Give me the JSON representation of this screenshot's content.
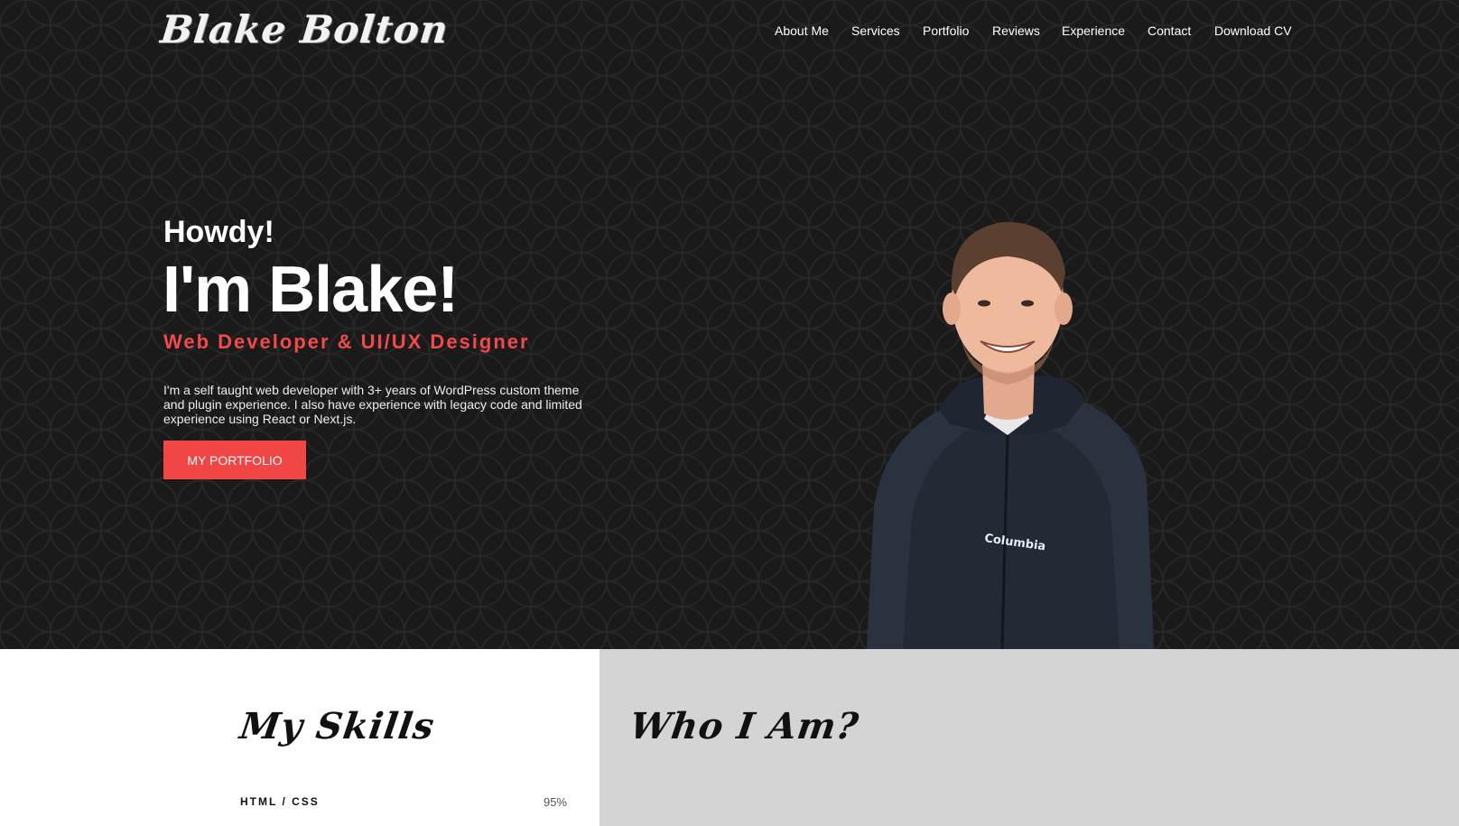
{
  "logo": {
    "text": "Blake Bolton"
  },
  "nav": {
    "items": [
      {
        "label": "About Me"
      },
      {
        "label": "Services"
      },
      {
        "label": "Portfolio"
      },
      {
        "label": "Reviews"
      },
      {
        "label": "Experience"
      },
      {
        "label": "Contact"
      },
      {
        "label": "Download CV"
      }
    ]
  },
  "hero": {
    "greeting": "Howdy!",
    "headline": "I'm Blake!",
    "role": "Web Developer & UI/UX Designer",
    "intro": "I'm a self taught web developer with 3+ years of WordPress custom theme and plugin experience. I also have experience with legacy code and limited experience using React or Next.js.",
    "cta_label": "MY PORTFOLIO"
  },
  "skills": {
    "title": "My Skills",
    "items": [
      {
        "name": "HTML / CSS",
        "percent_label": "95%",
        "percent": 95
      }
    ]
  },
  "about": {
    "title": "Who I Am?"
  },
  "colors": {
    "accent": "#f24545",
    "hero_bg": "#1a1a1b",
    "about_bg": "#d4d4d4"
  }
}
